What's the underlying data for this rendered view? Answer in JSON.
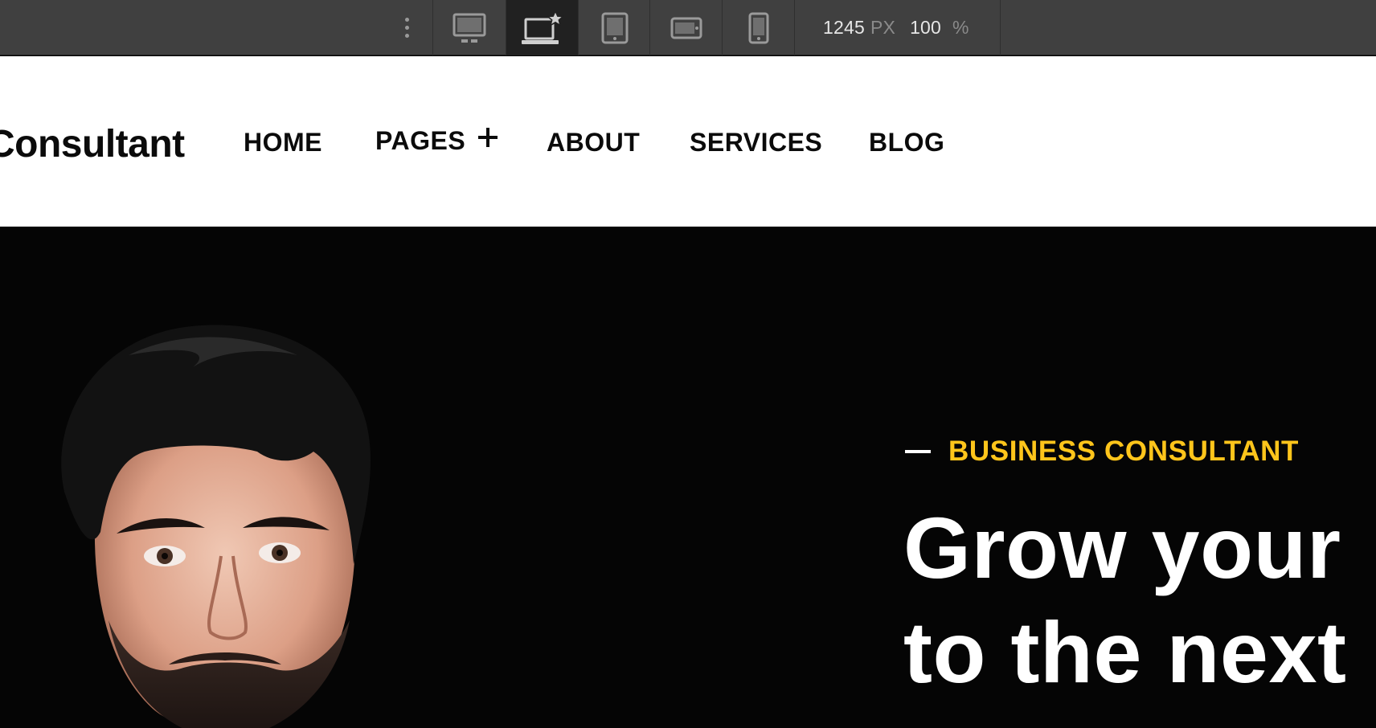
{
  "toolbar": {
    "breakpoints": [
      {
        "name": "desktop",
        "active": false
      },
      {
        "name": "laptop-base",
        "active": true
      },
      {
        "name": "tablet",
        "active": false
      },
      {
        "name": "mobile-landscape",
        "active": false
      },
      {
        "name": "mobile-portrait",
        "active": false
      }
    ],
    "width_value": "1245",
    "width_unit": "PX",
    "zoom_value": "100",
    "zoom_unit": "%",
    "colors": {
      "bar": "#404040",
      "active": "#212121",
      "icon": "#9a9a9a"
    }
  },
  "header": {
    "brand": "Consultant",
    "nav": [
      {
        "label": "HOME"
      },
      {
        "label": "PAGES",
        "icon": "plus-icon"
      },
      {
        "label": "ABOUT"
      },
      {
        "label": "SERVICES"
      },
      {
        "label": "BLOG"
      }
    ]
  },
  "hero": {
    "eyebrow": "BUSINESS CONSULTANT",
    "headline_line1": "Grow your",
    "headline_line2": "to the next",
    "colors": {
      "background": "#050505",
      "accent": "#ffc51b",
      "text": "#ffffff"
    }
  }
}
